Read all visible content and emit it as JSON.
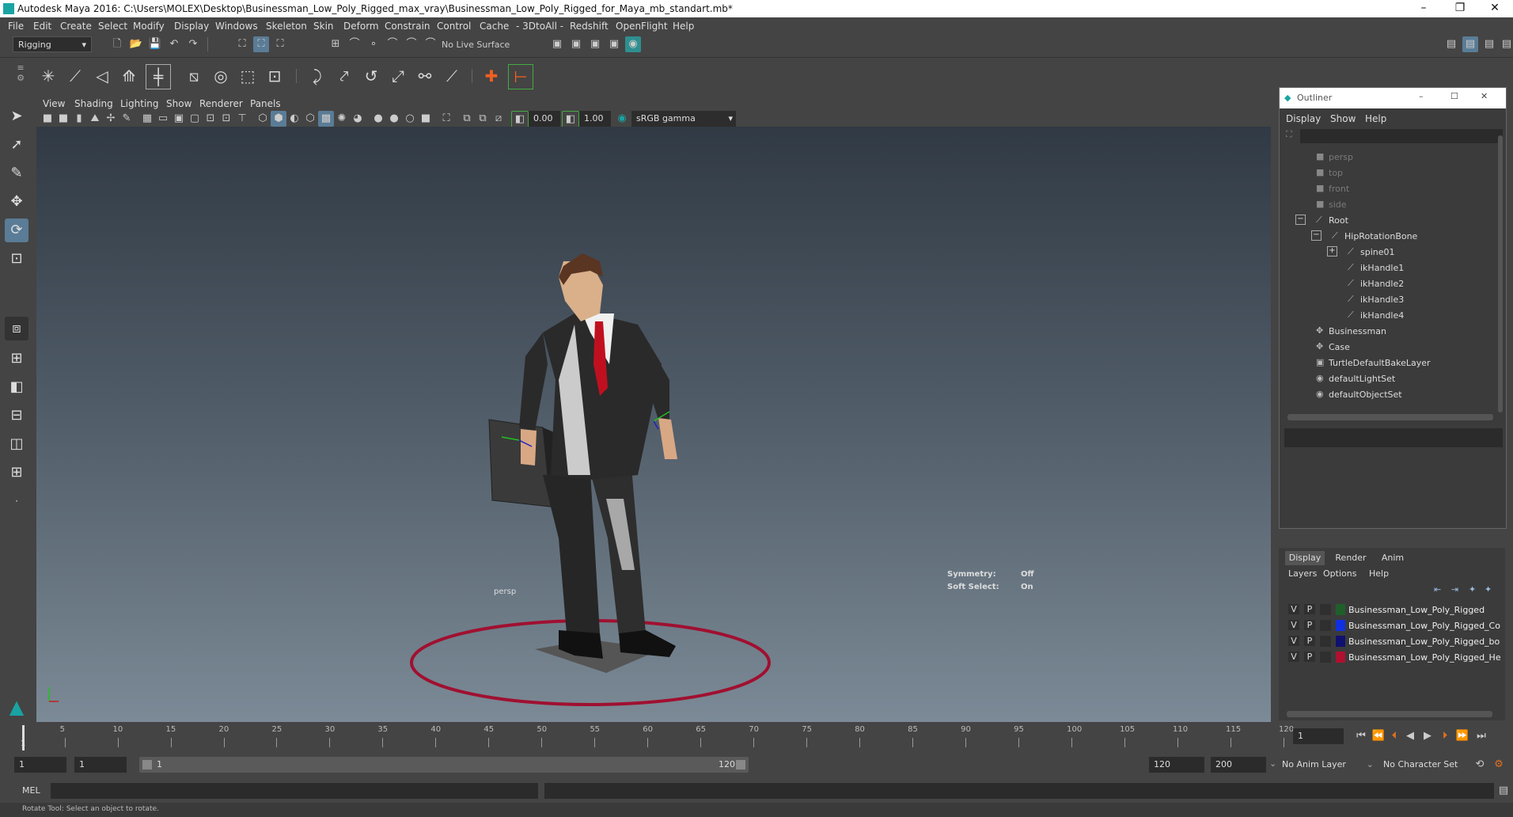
{
  "window": {
    "title": "Autodesk Maya 2016: C:\\Users\\MOLEX\\Desktop\\Businessman_Low_Poly_Rigged_max_vray\\Businessman_Low_Poly_Rigged_for_Maya_mb_standart.mb*",
    "minimize": "–",
    "restore": "❐",
    "close": "✕"
  },
  "menubar": [
    "File",
    "Edit",
    "Create",
    "Select",
    "Modify",
    "Display",
    "Windows",
    "Skeleton",
    "Skin",
    "Deform",
    "Constrain",
    "Control",
    "Cache",
    "- 3DtoAll -",
    "Redshift",
    "OpenFlight",
    "Help"
  ],
  "statusline": {
    "menuset": "Rigging",
    "live_surface": "No Live Surface"
  },
  "viewport": {
    "menu": [
      "View",
      "Shading",
      "Lighting",
      "Show",
      "Renderer",
      "Panels"
    ],
    "near_value": "0.00",
    "far_value": "1.00",
    "color_space": "sRGB gamma",
    "camera_label": "persp",
    "symmetry_label": "Symmetry:",
    "symmetry_value": "Off",
    "soft_select_label": "Soft Select:",
    "soft_select_value": "On"
  },
  "outliner": {
    "title": "Outliner",
    "menu": [
      "Display",
      "Show",
      "Help"
    ],
    "items": [
      {
        "label": "persp",
        "indent": 0,
        "dim": true,
        "icon": "camera-icon"
      },
      {
        "label": "top",
        "indent": 0,
        "dim": true,
        "icon": "camera-icon"
      },
      {
        "label": "front",
        "indent": 0,
        "dim": true,
        "icon": "camera-icon"
      },
      {
        "label": "side",
        "indent": 0,
        "dim": true,
        "icon": "camera-icon"
      },
      {
        "label": "Root",
        "indent": 0,
        "dim": false,
        "icon": "joint-icon",
        "expander": "−"
      },
      {
        "label": "HipRotationBone",
        "indent": 1,
        "dim": false,
        "icon": "joint-icon",
        "expander": "−"
      },
      {
        "label": "spine01",
        "indent": 2,
        "dim": false,
        "icon": "joint-icon",
        "expander": "+"
      },
      {
        "label": "ikHandle1",
        "indent": 2,
        "dim": false,
        "icon": "ik-handle-icon"
      },
      {
        "label": "ikHandle2",
        "indent": 2,
        "dim": false,
        "icon": "ik-handle-icon"
      },
      {
        "label": "ikHandle3",
        "indent": 2,
        "dim": false,
        "icon": "ik-handle-icon"
      },
      {
        "label": "ikHandle4",
        "indent": 2,
        "dim": false,
        "icon": "ik-handle-icon"
      },
      {
        "label": "Businessman",
        "indent": 0,
        "dim": false,
        "icon": "transform-icon"
      },
      {
        "label": "Case",
        "indent": 0,
        "dim": false,
        "icon": "transform-icon"
      },
      {
        "label": "TurtleDefaultBakeLayer",
        "indent": 0,
        "dim": false,
        "icon": "node-icon"
      },
      {
        "label": "defaultLightSet",
        "indent": 0,
        "dim": false,
        "icon": "set-icon"
      },
      {
        "label": "defaultObjectSet",
        "indent": 0,
        "dim": false,
        "icon": "set-icon"
      }
    ]
  },
  "layer_editor": {
    "tabs": [
      "Display",
      "Render",
      "Anim"
    ],
    "menu": [
      "Layers",
      "Options",
      "Help"
    ],
    "layers": [
      {
        "v": "V",
        "p": "P",
        "color": "#1f5f2a",
        "name": "Businessman_Low_Poly_Rigged"
      },
      {
        "v": "V",
        "p": "P",
        "color": "#1030e0",
        "name": "Businessman_Low_Poly_Rigged_Co"
      },
      {
        "v": "V",
        "p": "P",
        "color": "#101070",
        "name": "Businessman_Low_Poly_Rigged_bo"
      },
      {
        "v": "V",
        "p": "P",
        "color": "#b01030",
        "name": "Businessman_Low_Poly_Rigged_He"
      }
    ]
  },
  "timeline": {
    "ticks": [
      "5",
      "10",
      "15",
      "20",
      "25",
      "30",
      "35",
      "40",
      "45",
      "50",
      "55",
      "60",
      "65",
      "70",
      "75",
      "80",
      "85",
      "90",
      "95",
      "100",
      "105",
      "110",
      "115",
      "120"
    ],
    "current_frame": "1",
    "frame_start_marker": "1"
  },
  "range": {
    "start": "1",
    "playback_start": "1",
    "slider_start": "1",
    "slider_end": "120",
    "playback_end": "120",
    "end": "200",
    "anim_layer": "No Anim Layer",
    "character_set": "No Character Set"
  },
  "cmdline": {
    "label": "MEL"
  },
  "helpline": {
    "text": "Rotate Tool: Select an object to rotate."
  }
}
